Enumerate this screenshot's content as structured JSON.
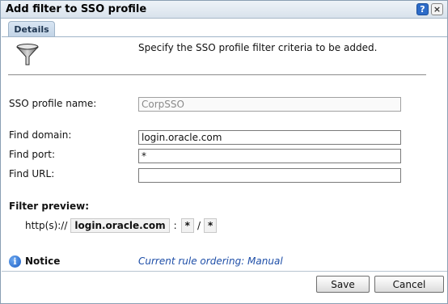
{
  "dialog": {
    "title": "Add filter to SSO profile",
    "help_symbol": "?",
    "close_symbol": "×"
  },
  "tabs": [
    {
      "label": "Details"
    }
  ],
  "instruction": "Specify the SSO profile filter criteria to be added.",
  "form": {
    "profile_name_label": "SSO profile name:",
    "profile_name_value": "CorpSSO",
    "domain_label": "Find domain:",
    "domain_value": "login.oracle.com",
    "port_label": "Find port:",
    "port_value": "*",
    "url_label": "Find URL:",
    "url_value": ""
  },
  "preview": {
    "title": "Filter preview:",
    "prefix": "http(s)://",
    "domain": "login.oracle.com",
    "colon": ":",
    "port": "*",
    "slash": "/",
    "path": "*"
  },
  "notice": {
    "icon_glyph": "i",
    "title": "Notice",
    "link_text": "Current rule ordering: Manual"
  },
  "buttons": {
    "save": "Save",
    "cancel": "Cancel"
  },
  "icons": {
    "funnel": "filter-funnel-icon",
    "help": "help-icon",
    "close": "close-icon",
    "info": "info-icon"
  }
}
